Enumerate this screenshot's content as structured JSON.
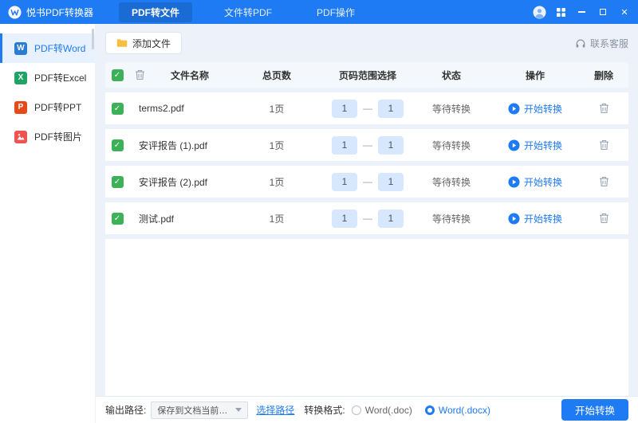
{
  "header": {
    "app_title": "悦书PDF转换器",
    "tabs": [
      {
        "label": "PDF转文件",
        "active": true
      },
      {
        "label": "文件转PDF",
        "active": false
      },
      {
        "label": "PDF操作",
        "active": false
      }
    ]
  },
  "sidebar": {
    "items": [
      {
        "label": "PDF转Word",
        "active": true,
        "icon": "word-file-icon",
        "icon_letter": "W",
        "icon_color": "#2b7cd3"
      },
      {
        "label": "PDF转Excel",
        "active": false,
        "icon": "excel-file-icon",
        "icon_letter": "X",
        "icon_color": "#21a366"
      },
      {
        "label": "PDF转PPT",
        "active": false,
        "icon": "ppt-file-icon",
        "icon_letter": "P",
        "icon_color": "#e64a19"
      },
      {
        "label": "PDF转图片",
        "active": false,
        "icon": "image-file-icon",
        "icon_letter": "",
        "icon_color": "#ef5350"
      }
    ]
  },
  "toolbar": {
    "add_file_label": "添加文件",
    "contact_support_label": "联系客服"
  },
  "table": {
    "headers": [
      "文件名称",
      "总页数",
      "页码范围选择",
      "状态",
      "操作",
      "删除"
    ],
    "range_separator": "—",
    "rows": [
      {
        "name": "terms2.pdf",
        "pages": "1页",
        "page_from": "1",
        "page_to": "1",
        "status": "等待转换",
        "action_label": "开始转换"
      },
      {
        "name": "安评报告 (1).pdf",
        "pages": "1页",
        "page_from": "1",
        "page_to": "1",
        "status": "等待转换",
        "action_label": "开始转换"
      },
      {
        "name": "安评报告 (2).pdf",
        "pages": "1页",
        "page_from": "1",
        "page_to": "1",
        "status": "等待转换",
        "action_label": "开始转换"
      },
      {
        "name": "测试.pdf",
        "pages": "1页",
        "page_from": "1",
        "page_to": "1",
        "status": "等待转换",
        "action_label": "开始转换"
      }
    ]
  },
  "footer": {
    "output_path_label": "输出路径:",
    "output_path_value": "保存到文档当前目录",
    "choose_path_label": "选择路径",
    "format_label": "转换格式:",
    "format_options": [
      {
        "label": "Word(.doc)",
        "selected": false
      },
      {
        "label": "Word(.docx)",
        "selected": true
      }
    ],
    "start_button_label": "开始转换"
  },
  "colors": {
    "header_bg": "#1f7bf4",
    "accent_blue": "#1f7bf4",
    "checkbox_green": "#3db157",
    "page_input_bg": "#d7e7fd",
    "main_bg": "#edf2fa"
  }
}
